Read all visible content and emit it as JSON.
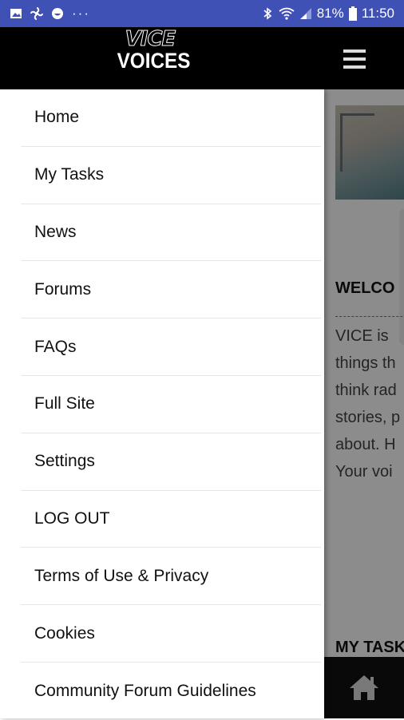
{
  "status_bar": {
    "battery": "81%",
    "time": "11:50",
    "icons": [
      "gallery-icon",
      "fan-icon",
      "face-icon",
      "more-icon",
      "bluetooth-icon",
      "wifi-icon",
      "signal-icon",
      "battery-icon"
    ],
    "overflow_dots": "···"
  },
  "header": {
    "logo_top": "VICE",
    "logo_bottom": "VOICES"
  },
  "menu": {
    "items": [
      {
        "label": "Home"
      },
      {
        "label": "My Tasks"
      },
      {
        "label": "News"
      },
      {
        "label": "Forums"
      },
      {
        "label": "FAQs"
      },
      {
        "label": "Full Site"
      },
      {
        "label": "Settings"
      },
      {
        "label": "LOG OUT"
      },
      {
        "label": "Terms of Use & Privacy"
      },
      {
        "label": "Cookies"
      },
      {
        "label": "Community Forum Guidelines"
      }
    ]
  },
  "background_content": {
    "welcome_heading": "WELCO",
    "paragraph_lines": [
      "VICE is",
      "things th",
      "think rad",
      "stories, p",
      "about. H",
      "Your voi"
    ],
    "mytasks_heading": "MY TASK"
  },
  "colors": {
    "status_bar": "#3f51b5",
    "header": "#000000"
  }
}
